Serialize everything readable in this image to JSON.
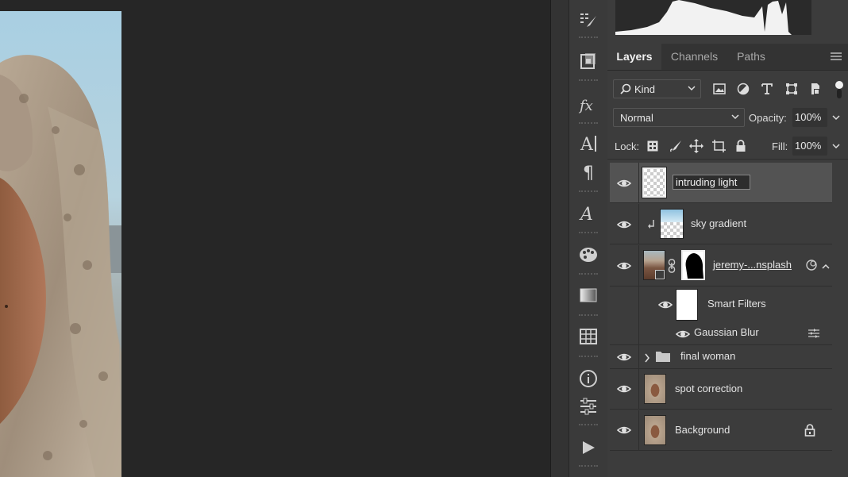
{
  "panel": {
    "tabs": [
      {
        "label": "Layers",
        "active": true
      },
      {
        "label": "Channels",
        "active": false
      },
      {
        "label": "Paths",
        "active": false
      }
    ],
    "filter": {
      "kind_label": "Kind"
    },
    "blend": {
      "mode": "Normal",
      "opacity_label": "Opacity:",
      "opacity_value": "100%"
    },
    "lock": {
      "label": "Lock:",
      "fill_label": "Fill:",
      "fill_value": "100%"
    }
  },
  "layers": [
    {
      "name": "intruding light",
      "editing": true,
      "selected": true
    },
    {
      "name": "sky gradient",
      "clipped": true
    },
    {
      "name": "jeremy-...nsplash",
      "smart_object": true,
      "has_mask": true
    },
    {
      "name": "Smart Filters",
      "sublayer": true
    },
    {
      "name": "Gaussian Blur",
      "filter": true
    },
    {
      "name": "final woman",
      "group": true
    },
    {
      "name": "spot correction"
    },
    {
      "name": "Background",
      "locked": true
    }
  ],
  "toolbar": {
    "icons": [
      "brush-settings-icon",
      "clone-source-icon",
      "fx-styles-icon",
      "character-icon",
      "paragraph-icon",
      "glyphs-icon",
      "color-palette-icon",
      "gradient-swatch-icon",
      "table-icon",
      "info-icon",
      "adjustments-icon",
      "play-actions-icon"
    ]
  },
  "colors": {
    "panel_bg": "#3c3c3c",
    "selected_row": "#535353",
    "canvas_bg": "#262626"
  }
}
